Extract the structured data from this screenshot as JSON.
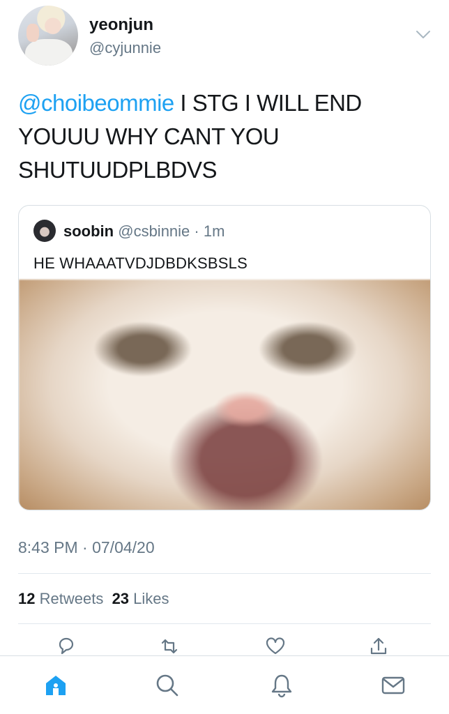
{
  "tweet": {
    "author_name": "yeonjun",
    "author_handle": "@cyjunnie",
    "mention": "@choibeommie",
    "text": " I STG I WILL END YOUUU WHY CANT YOU SHUTUUDPLBDVS",
    "timestamp": "8:43 PM · 07/04/20"
  },
  "quoted": {
    "name": "soobin",
    "handle": "@csbinnie",
    "age": " · 1m",
    "text": "HE WHAAATVDJDBDKSBSLS"
  },
  "stats": {
    "retweets_count": "12",
    "retweets_label": "Retweets",
    "likes_count": "23",
    "likes_label": "Likes"
  },
  "actions": [
    "reply-icon",
    "retweet-icon",
    "like-icon",
    "share-icon"
  ],
  "tabs": [
    "home-icon",
    "search-icon",
    "notifications-icon",
    "messages-icon"
  ],
  "colors": {
    "accent": "#1da1f2",
    "text": "#14171a",
    "secondary": "#657786",
    "border": "#e1e8ed"
  }
}
